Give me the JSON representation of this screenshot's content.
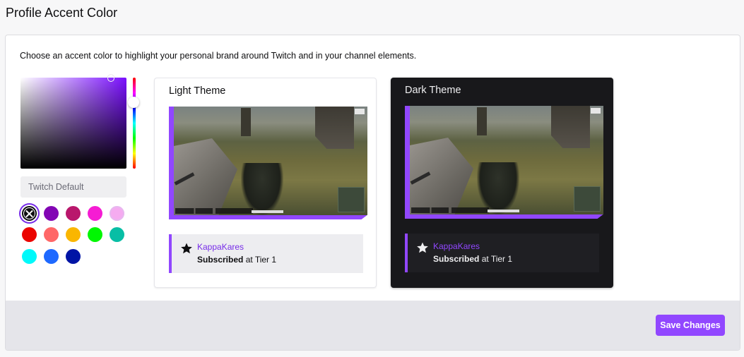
{
  "header": {
    "title": "Profile Accent Color"
  },
  "description": "Choose an accent color to highlight your personal brand around Twitch and in your channel elements.",
  "picker": {
    "selected_hue_color": "#7a0fff",
    "input_placeholder": "Twitch Default"
  },
  "swatches": [
    {
      "name": "twitch-default",
      "color": "#0e0e10",
      "selected": true
    },
    {
      "name": "purple",
      "color": "#8205b4"
    },
    {
      "name": "magenta",
      "color": "#b9176c"
    },
    {
      "name": "pink",
      "color": "#f51cd3"
    },
    {
      "name": "lavender",
      "color": "#f5abf0"
    },
    {
      "name": "red",
      "color": "#eb0400"
    },
    {
      "name": "coral",
      "color": "#ff6767"
    },
    {
      "name": "orange",
      "color": "#fab600"
    },
    {
      "name": "green",
      "color": "#00f702"
    },
    {
      "name": "teal",
      "color": "#08bea5"
    },
    {
      "name": "cyan",
      "color": "#00f9fa"
    },
    {
      "name": "blue",
      "color": "#1e69ff"
    },
    {
      "name": "navy",
      "color": "#0014a5"
    }
  ],
  "light_theme": {
    "title": "Light Theme",
    "username": "KappaKares",
    "sub_bold": "Subscribed",
    "sub_rest": " at Tier 1"
  },
  "dark_theme": {
    "title": "Dark Theme",
    "username": "KappaKares",
    "sub_bold": "Subscribed",
    "sub_rest": " at Tier 1"
  },
  "accent_color": "#9147ff",
  "footer": {
    "save_label": "Save Changes"
  }
}
